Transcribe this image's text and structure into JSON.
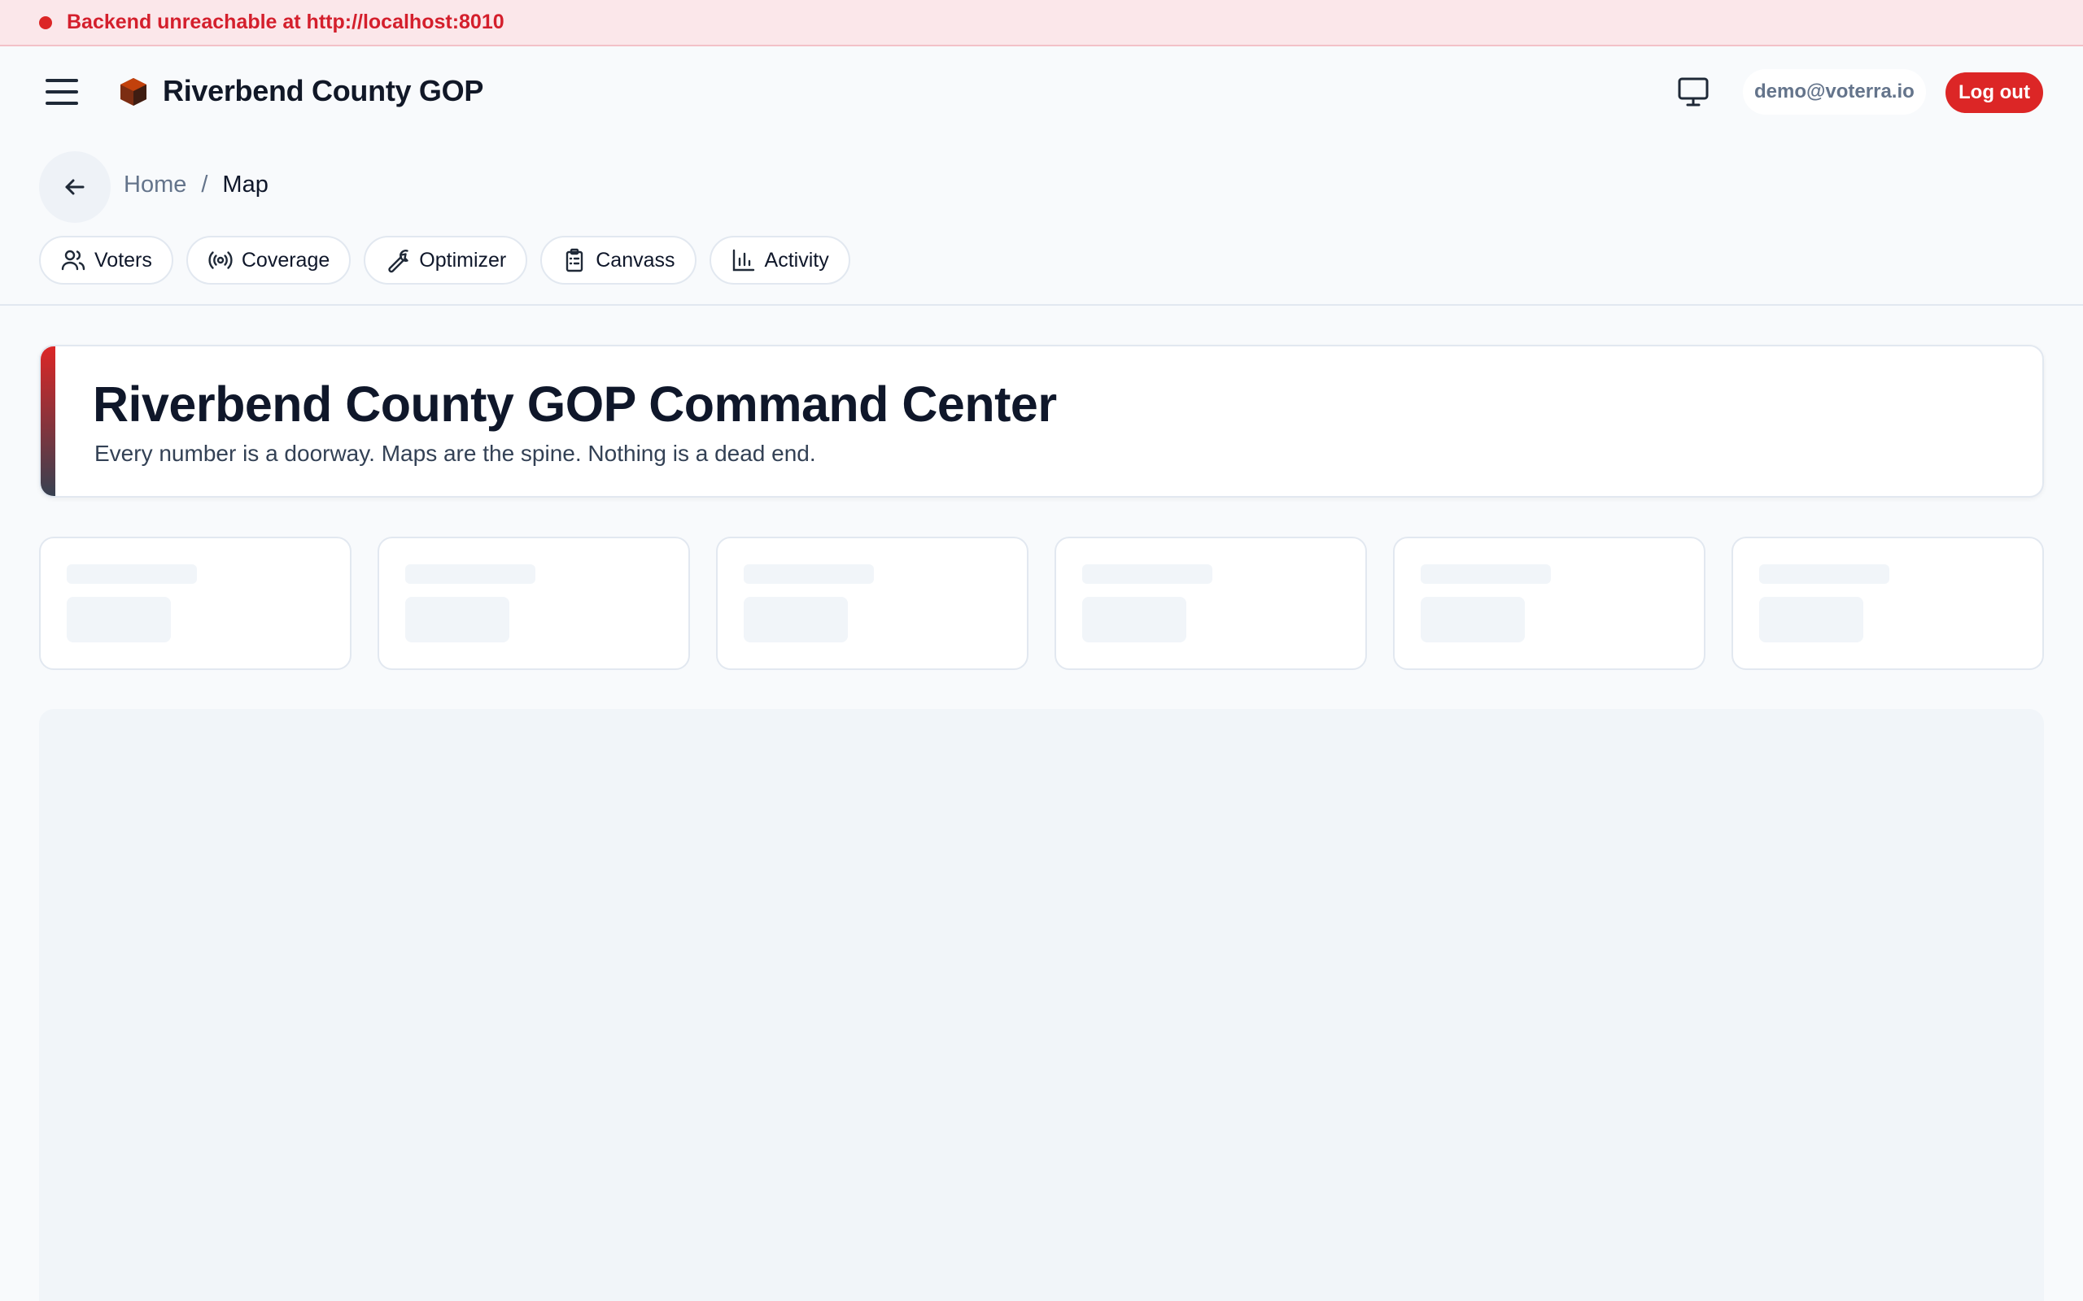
{
  "banner": {
    "message": "Backend unreachable at http://localhost:8010",
    "color": "#dc2626"
  },
  "header": {
    "brand": "Riverbend County GOP",
    "user_email": "demo@voterra.io",
    "logout_label": "Log out",
    "accent": "#dc2626"
  },
  "breadcrumb": {
    "home": "Home",
    "separator": "/",
    "current": "Map"
  },
  "nav": [
    {
      "label": "Voters",
      "icon": "users-icon"
    },
    {
      "label": "Coverage",
      "icon": "broadcast-icon"
    },
    {
      "label": "Optimizer",
      "icon": "wrench-icon"
    },
    {
      "label": "Canvass",
      "icon": "clipboard-icon"
    },
    {
      "label": "Activity",
      "icon": "bar-chart-icon"
    }
  ],
  "hero": {
    "title": "Riverbend County GOP Command Center",
    "subtitle": "Every number is a doorway. Maps are the spine. Nothing is a dead end."
  },
  "stat_cards": {
    "count": 6,
    "state": "loading"
  }
}
